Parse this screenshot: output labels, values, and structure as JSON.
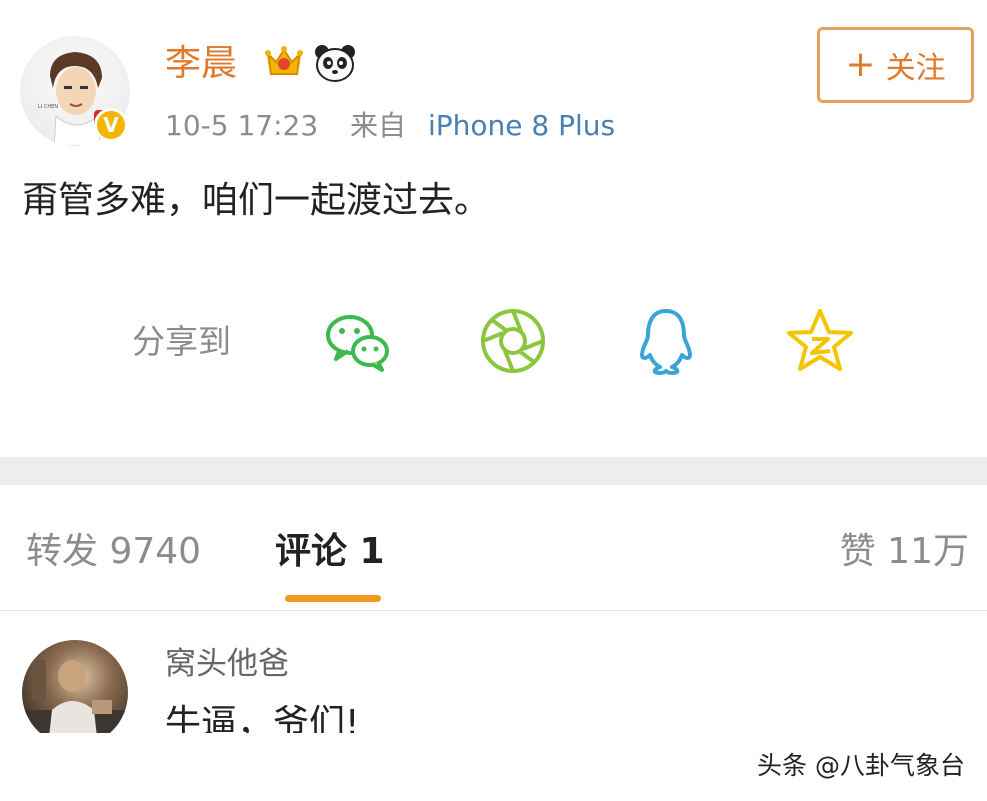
{
  "post": {
    "username": "李晨",
    "time": "10-5 17:23",
    "from_label": "来自",
    "device": "iPhone 8 Plus",
    "follow_label": "关注",
    "follow_plus": "+",
    "text": "甭管多难，咱们一起渡过去。"
  },
  "share": {
    "label": "分享到",
    "targets": [
      "wechat-icon",
      "moments-icon",
      "qq-icon",
      "qzone-icon"
    ]
  },
  "tabs": {
    "repost": "转发 9740",
    "comment": "评论 1",
    "like": "赞 11万"
  },
  "comment": {
    "user": "窝头他爸",
    "text": "牛逼，爷们!"
  },
  "watermark": "头条 @八卦气象台",
  "colors": {
    "accent": "#e07a2b",
    "link": "#4a7fb3",
    "tab_underline": "#f19a1f",
    "muted": "#8c8c8c",
    "wechat": "#3dba4e",
    "moments": "#8cc63f",
    "qq": "#3aa3d8",
    "qzone": "#f5c400"
  }
}
